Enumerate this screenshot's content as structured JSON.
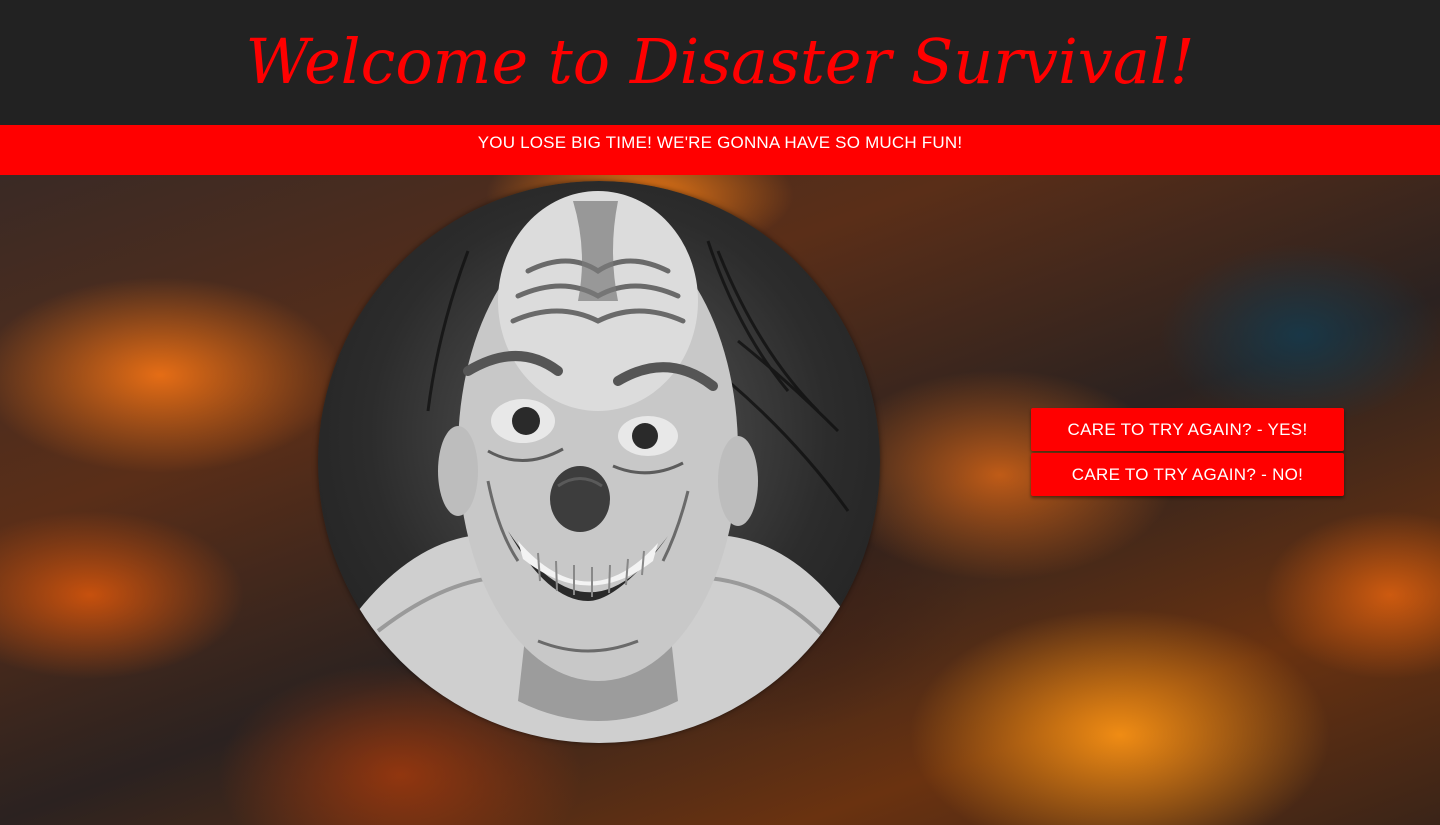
{
  "header": {
    "title": "Welcome to Disaster Survival!"
  },
  "banner": {
    "message": "YOU LOSE BIG TIME! WE'RE GONNA HAVE SO MUCH FUN!"
  },
  "image": {
    "subject": "creepy-clown-icon"
  },
  "actions": {
    "retry_yes_label": "CARE TO TRY AGAIN? - YES!",
    "retry_no_label": "CARE TO TRY AGAIN? - NO!"
  },
  "colors": {
    "accent": "#ff0000",
    "header_bg": "#222222",
    "title_color": "#ff0000",
    "banner_bg": "#ff0000",
    "button_bg": "#ff0000",
    "button_text": "#ffffff"
  }
}
